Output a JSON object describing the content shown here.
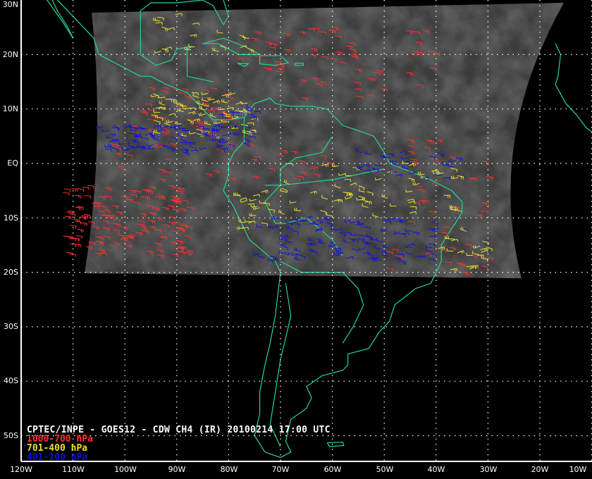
{
  "title": "CPTEC/INPE - GOES12 - CDW CH4 (IR) 20100214 17:00 UTC",
  "legend": [
    {
      "label": "1000-700 hPa",
      "color": "#ff3030"
    },
    {
      "label": "701-400 hPa",
      "color": "#e8e030"
    },
    {
      "label": "401-100 hPa",
      "color": "#1010e0"
    }
  ],
  "lat_labels": [
    "30N",
    "20N",
    "10N",
    "EQ",
    "10S",
    "20S",
    "30S",
    "40S",
    "50S"
  ],
  "lon_labels": [
    "120W",
    "110W",
    "100W",
    "90W",
    "80W",
    "70W",
    "60W",
    "50W",
    "40W",
    "30W",
    "20W",
    "10W"
  ],
  "colors": {
    "coast": "#20d890",
    "grid": "#ffffff",
    "frame": "#ffffff"
  }
}
